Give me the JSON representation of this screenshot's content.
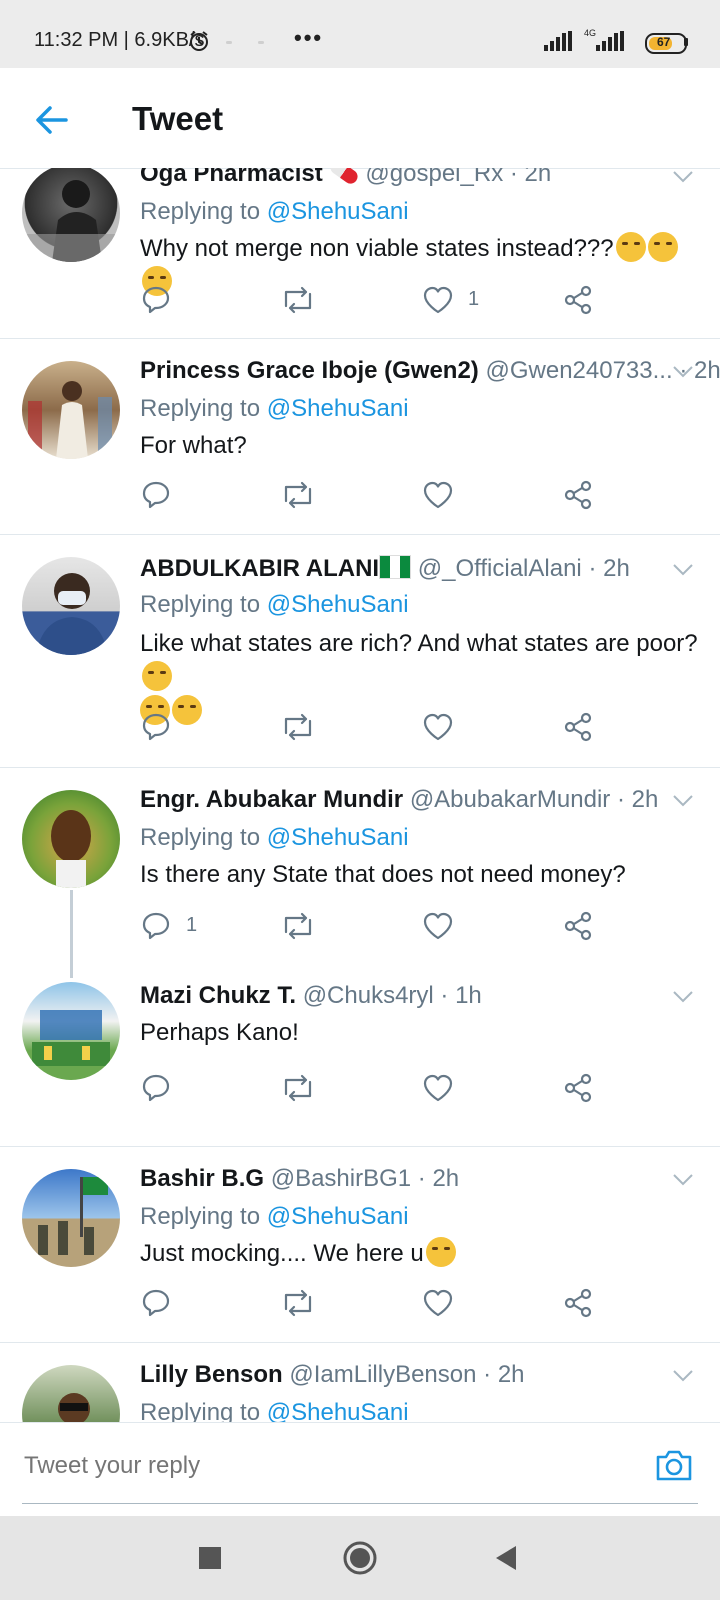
{
  "status_bar": {
    "time_speed": "11:32 PM | 6.9KB/s",
    "more": "•••",
    "network": "4G",
    "battery": "67",
    "battery_color": "#f3b431"
  },
  "header": {
    "back_icon": "arrow-left-icon",
    "title": "Tweet"
  },
  "colors": {
    "accent": "#1b95e0",
    "secondary_text": "#657786",
    "divider": "#e1e8ed"
  },
  "tweets": [
    {
      "name": "Oga Pharmacist",
      "handle": "@gospel_Rx",
      "time": "· 2h",
      "replying_prefix": "Replying to",
      "replying_to": "@ShehuSani",
      "text": "Why not merge non viable states instead???",
      "comment_count": "",
      "like_count": "1"
    },
    {
      "name": "Princess Grace Iboje (Gwen2)",
      "handle": "@Gwen240733...",
      "time": "· 2h",
      "replying_prefix": "Replying to",
      "replying_to": "@ShehuSani",
      "text": "For what?",
      "comment_count": "",
      "like_count": ""
    },
    {
      "name": "ABDULKABIR ALANI",
      "handle": "@_OfficialAlani",
      "time": "· 2h",
      "replying_prefix": "Replying to",
      "replying_to": "@ShehuSani",
      "text": "Like what states are rich? And what states are poor?",
      "comment_count": "",
      "like_count": ""
    },
    {
      "name": "Engr. Abubakar Mundir",
      "handle": "@AbubakarMundir",
      "time": "· 2h",
      "replying_prefix": "Replying to",
      "replying_to": "@ShehuSani",
      "text": "Is there any State that does not need money?",
      "comment_count": "1",
      "like_count": ""
    },
    {
      "name": "Mazi Chukz T.",
      "handle": "@Chuks4ryl",
      "time": "· 1h",
      "text": "Perhaps Kano!",
      "comment_count": "",
      "like_count": ""
    },
    {
      "name": "Bashir B.G",
      "handle": "@BashirBG1",
      "time": "· 2h",
      "replying_prefix": "Replying to",
      "replying_to": "@ShehuSani",
      "text": "Just mocking.... We here u",
      "comment_count": "",
      "like_count": ""
    },
    {
      "name": "Lilly Benson",
      "handle": "@IamLillyBenson",
      "time": "· 2h",
      "replying_prefix": "Replying to",
      "replying_to": "@ShehuSani"
    }
  ],
  "reply_bar": {
    "placeholder": "Tweet your reply",
    "camera_icon": "camera-icon"
  },
  "nav_bar": {
    "recents_icon": "square-icon",
    "home_icon": "circle-icon",
    "back_icon": "triangle-back-icon"
  }
}
